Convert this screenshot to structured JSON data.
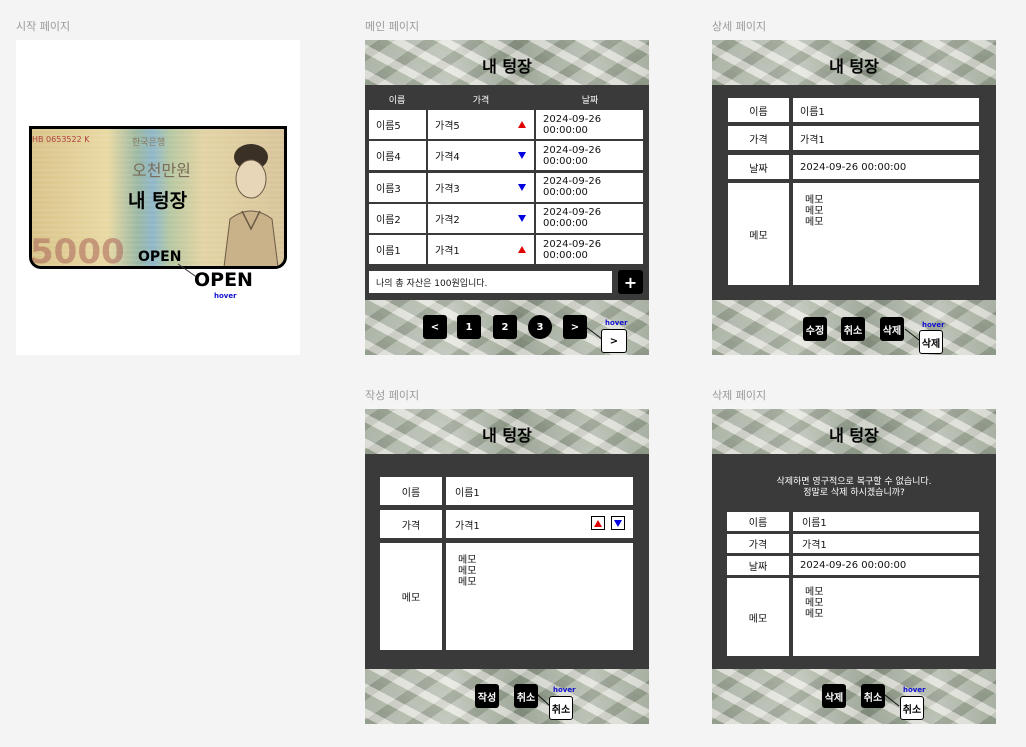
{
  "frames": {
    "start": "시작 페이지",
    "main": "메인 페이지",
    "detail": "상세 페이지",
    "write": "작성 페이지",
    "delete": "삭제 페이지"
  },
  "app_title": "내 텅장",
  "start_page": {
    "banknote_serial": "HB 0653522 K",
    "banknote_korea": "한국은행",
    "banknote_amount_kr": "오천만원",
    "banknote_number": "5000",
    "open_label": "OPEN",
    "open_hover_label": "OPEN",
    "hover_tag": "hover"
  },
  "main_page": {
    "columns": [
      "이름",
      "가격",
      "날짜"
    ],
    "rows": [
      {
        "name": "이름5",
        "price": "가격5",
        "trend": "up",
        "date": "2024-09-26 00:00:00"
      },
      {
        "name": "이름4",
        "price": "가격4",
        "trend": "down",
        "date": "2024-09-26 00:00:00"
      },
      {
        "name": "이름3",
        "price": "가격3",
        "trend": "down",
        "date": "2024-09-26 00:00:00"
      },
      {
        "name": "이름2",
        "price": "가격2",
        "trend": "down",
        "date": "2024-09-26 00:00:00"
      },
      {
        "name": "이름1",
        "price": "가격1",
        "trend": "up",
        "date": "2024-09-26 00:00:00"
      }
    ],
    "total_text": "나의 총 자산은 100원입니다.",
    "add_label": "+",
    "pagination": {
      "prev": "<",
      "pages": [
        "1",
        "2",
        "3"
      ],
      "current": "3",
      "next": ">",
      "next_hover": ">",
      "hover_tag": "hover"
    }
  },
  "detail_page": {
    "labels": {
      "name": "이름",
      "price": "가격",
      "date": "날짜",
      "memo": "메모"
    },
    "values": {
      "name": "이름1",
      "price": "가격1",
      "date": "2024-09-26 00:00:00",
      "memo": "메모\n메모\n메모"
    },
    "buttons": {
      "edit": "수정",
      "cancel": "취소",
      "delete": "삭제",
      "delete_hover": "삭제",
      "hover_tag": "hover"
    }
  },
  "write_page": {
    "labels": {
      "name": "이름",
      "price": "가격",
      "memo": "메모"
    },
    "values": {
      "name": "이름1",
      "price": "가격1",
      "memo": "메모\n메모\n메모"
    },
    "buttons": {
      "write": "작성",
      "cancel": "취소",
      "cancel_hover": "취소",
      "hover_tag": "hover"
    }
  },
  "delete_page": {
    "warning_line1": "삭제하면 영구적으로 복구할 수 없습니다.",
    "warning_line2": "정말로 삭제 하시겠습니까?",
    "labels": {
      "name": "이름",
      "price": "가격",
      "date": "날짜",
      "memo": "메모"
    },
    "values": {
      "name": "이름1",
      "price": "가격1",
      "date": "2024-09-26 00:00:00",
      "memo": "메모\n메모\n메모"
    },
    "buttons": {
      "delete": "삭제",
      "cancel": "취소",
      "cancel_hover": "취소",
      "hover_tag": "hover"
    }
  },
  "colors": {
    "up": "#e00000",
    "down": "#0000e0",
    "hover_tag": "#1010d0",
    "panel": "#3a3a3a"
  }
}
